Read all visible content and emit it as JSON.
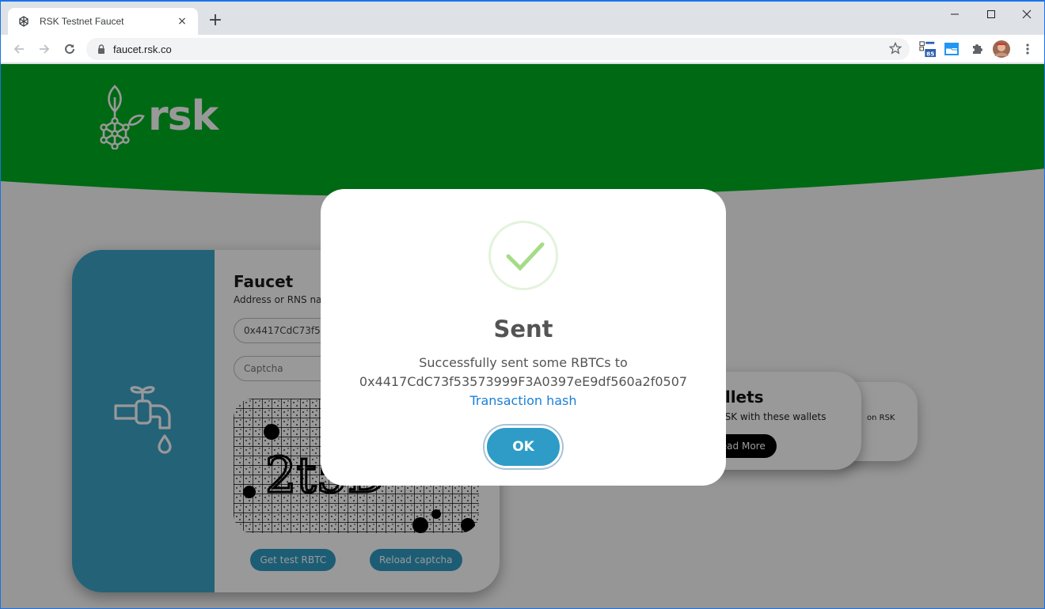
{
  "browser": {
    "tab_title": "RSK Testnet Faucet",
    "tab_close": "×",
    "new_tab": "+",
    "url": "faucet.rsk.co",
    "extension_badge": "85",
    "window_controls": {
      "minimize": "—",
      "maximize": "□",
      "close": "✕"
    }
  },
  "colors": {
    "brand_green": "#00A81A",
    "teal": "#3CA3C9",
    "button_teal": "#2F9BC4",
    "success_green": "#a5dc86",
    "link_blue": "#1a7fd6"
  },
  "header": {
    "logo_text": "rsk"
  },
  "faucet": {
    "title": "Faucet",
    "subtitle": "Address or RNS name",
    "address_value": "0x4417CdC73f53573999F3A0397eE9df560a2f0507",
    "captcha_placeholder": "Captcha",
    "captcha_text": "2t5D",
    "get_button": "Get test RBTC",
    "reload_button": "Reload captcha"
  },
  "wallets": {
    "title": "Wallets",
    "subtitle": "Use RSK with these wallets",
    "button": "Read More",
    "back_card_text": "on RSK"
  },
  "modal": {
    "title": "Sent",
    "message": "Successfully sent some RBTCs to",
    "address": "0x4417CdC73f53573999F3A0397eE9df560a2f0507",
    "link": "Transaction hash",
    "ok_button": "OK"
  }
}
